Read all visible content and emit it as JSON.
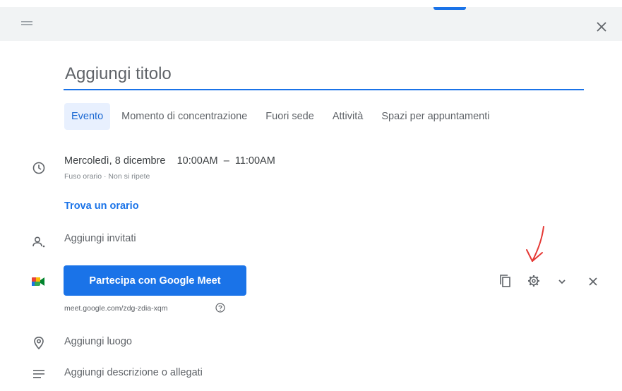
{
  "header": {
    "drag_icon": "drag-handle-icon",
    "close_icon": "close-icon"
  },
  "title_field": {
    "placeholder": "Aggiungi titolo",
    "value": ""
  },
  "tabs": [
    {
      "label": "Evento",
      "active": true
    },
    {
      "label": "Momento di concentrazione",
      "active": false
    },
    {
      "label": "Fuori sede",
      "active": false
    },
    {
      "label": "Attività",
      "active": false
    },
    {
      "label": "Spazi per appuntamenti",
      "active": false
    }
  ],
  "event": {
    "date": "Mercoledì, 8 dicembre",
    "start_time": "10:00AM",
    "time_separator": "–",
    "end_time": "11:00AM",
    "sub_info": "Fuso orario · Non si ripete",
    "find_time": "Trova un orario"
  },
  "guests": {
    "placeholder": "Aggiungi invitati"
  },
  "meet": {
    "button_label": "Partecipa con Google Meet",
    "link": "meet.google.com/zdg-zdia-xqm"
  },
  "location": {
    "placeholder": "Aggiungi luogo"
  },
  "description": {
    "placeholder": "Aggiungi descrizione o allegati"
  },
  "colors": {
    "accent": "#1a73e8",
    "tab_active_bg": "#e8f0fe",
    "annotation_arrow": "#e53935"
  }
}
